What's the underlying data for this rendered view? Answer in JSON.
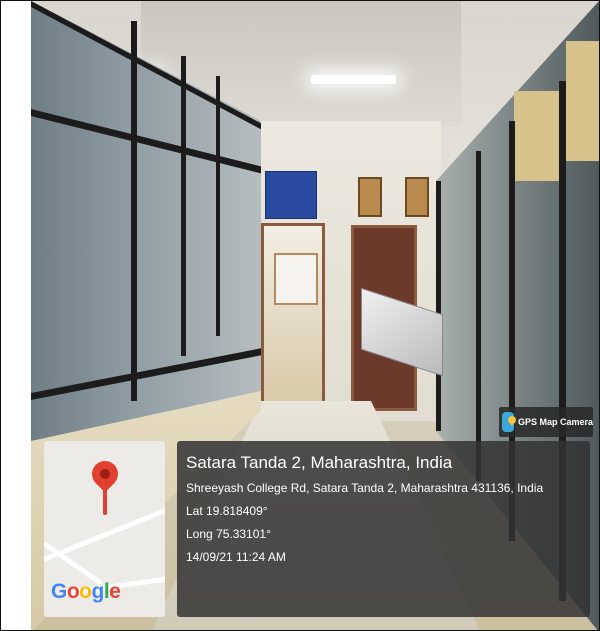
{
  "gps_badge": {
    "label": "GPS Map Camera",
    "icon": "gps-map-camera-icon"
  },
  "map": {
    "logo_text": "Google",
    "pin_color": "#e2402f"
  },
  "location": {
    "title": "Satara Tanda 2, Maharashtra, India",
    "address": "Shreeyash College Rd, Satara Tanda 2, Maharashtra 431136, India",
    "lat": "Lat 19.818409°",
    "long": "Long 75.33101°",
    "datetime": "14/09/21 11:24 AM"
  }
}
